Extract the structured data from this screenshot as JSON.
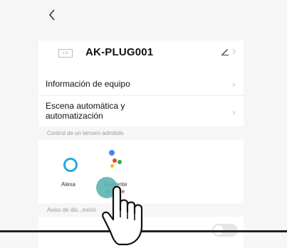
{
  "header": {
    "back_icon": "chevron-left-icon"
  },
  "device": {
    "name": "AK-PLUG001",
    "edit_icon": "pencil-icon"
  },
  "menu": {
    "items": [
      {
        "label": "Información de equipo"
      },
      {
        "label": "Escena automática y automatización"
      }
    ]
  },
  "third_party": {
    "section_title": "Control de un tercero admitido",
    "services": [
      {
        "name": "Alexa"
      },
      {
        "name": "Asistente Google"
      }
    ]
  },
  "notification": {
    "section_title": "Aviso de dis...exión"
  },
  "colors": {
    "alexa": "#27a9e0",
    "google_blue": "#4285f4",
    "google_red": "#ea4335",
    "google_yellow": "#fbbc05",
    "google_green": "#34a853",
    "touch": "#5bb4b3"
  }
}
